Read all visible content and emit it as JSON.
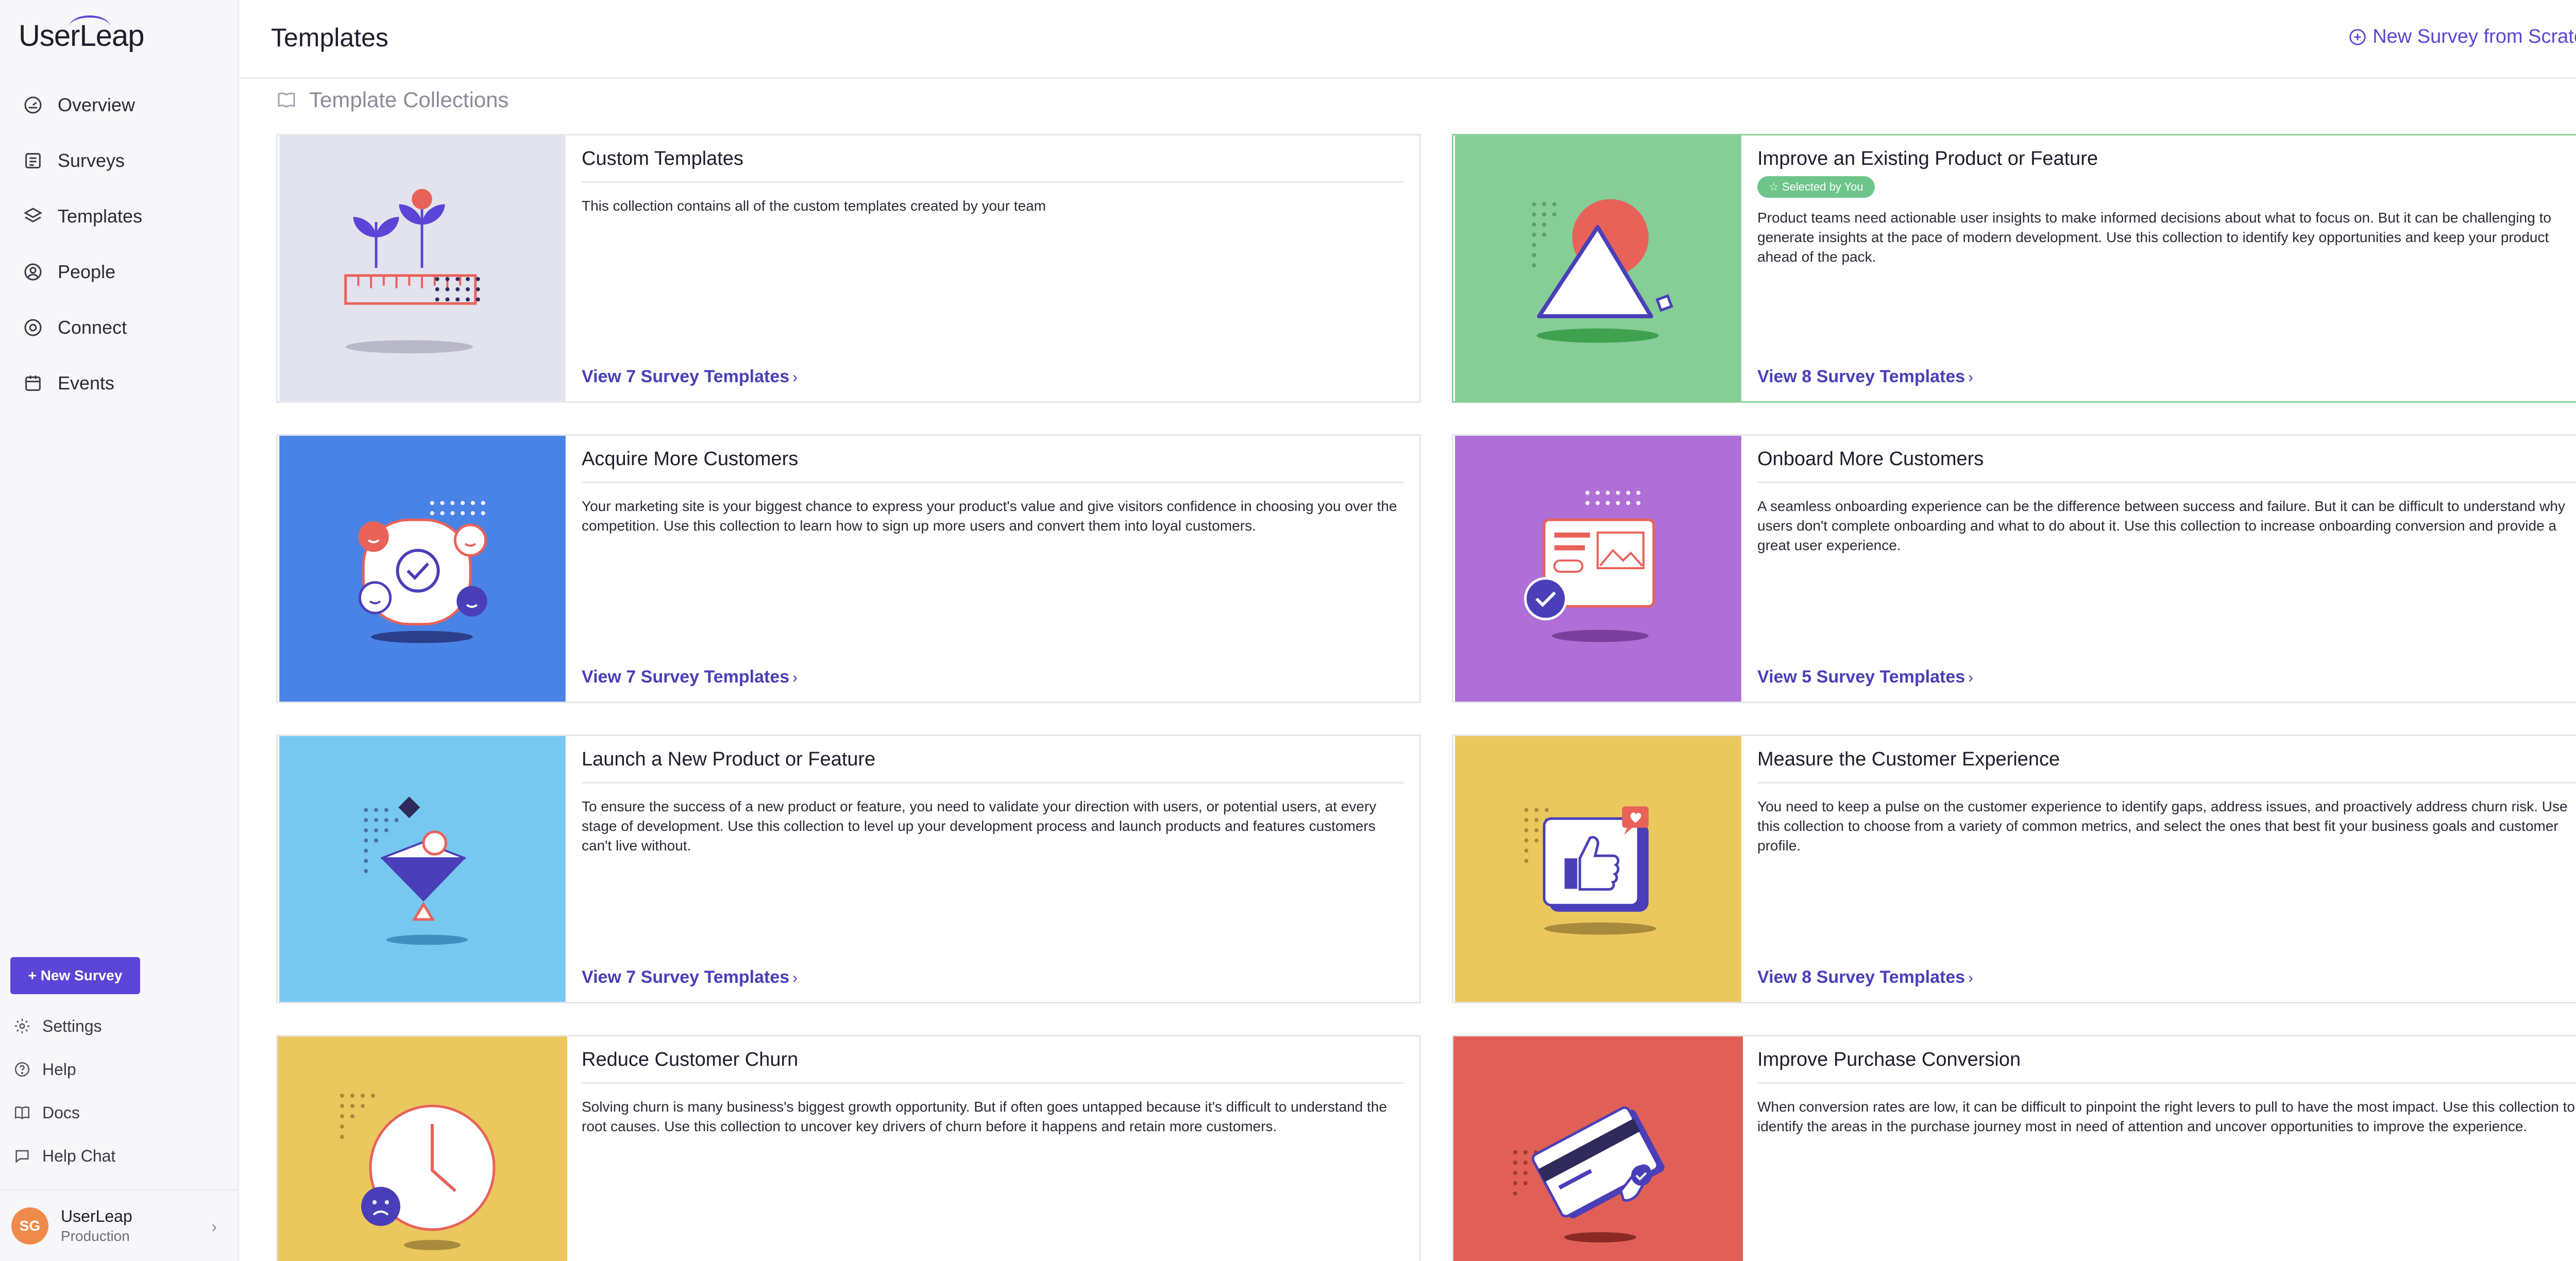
{
  "brand": "UserLeap",
  "sidebar": {
    "nav": [
      {
        "label": "Overview",
        "icon": "dashboard-icon"
      },
      {
        "label": "Surveys",
        "icon": "surveys-icon"
      },
      {
        "label": "Templates",
        "icon": "layers-icon"
      },
      {
        "label": "People",
        "icon": "person-icon"
      },
      {
        "label": "Connect",
        "icon": "connect-icon"
      },
      {
        "label": "Events",
        "icon": "calendar-icon"
      }
    ],
    "new_survey_label": "+ New Survey",
    "bottom": [
      {
        "label": "Settings",
        "icon": "gear-icon"
      },
      {
        "label": "Help",
        "icon": "help-icon"
      },
      {
        "label": "Docs",
        "icon": "book-icon"
      },
      {
        "label": "Help Chat",
        "icon": "chat-icon"
      }
    ],
    "account": {
      "initials": "SG",
      "name": "UserLeap",
      "env": "Production"
    }
  },
  "header": {
    "title": "Templates",
    "new_scratch_label": "New Survey from Scratch"
  },
  "collections_label": "Template Collections",
  "cards": [
    {
      "title": "Custom Templates",
      "badge": "",
      "desc": "This collection contains all of the custom templates created by your team",
      "link": "View 7 Survey Templates",
      "color": "#e4e4ee",
      "art": "plants-ruler"
    },
    {
      "title": "Improve an Existing Product or Feature",
      "badge": "☆ Selected by You",
      "desc": "Product teams need actionable user insights to make informed decisions about what to focus on. But it can be challenging to generate insights at the pace of modern development. Use this collection to identify key opportunities and keep your product ahead of the pack.",
      "link": "View 8 Survey Templates",
      "color": "#86cd96",
      "art": "triangle-sun"
    },
    {
      "title": "Acquire More Customers",
      "badge": "",
      "desc": "Your marketing site is your biggest chance to express your product's value and give visitors confidence in choosing you over the competition. Use this collection to learn how to sign up more users and convert them into loyal customers.",
      "link": "View 7 Survey Templates",
      "color": "#4a83e6",
      "art": "faces-check"
    },
    {
      "title": "Onboard More Customers",
      "badge": "",
      "desc": "A seamless onboarding experience can be the difference between success and failure. But it can be difficult to understand why users don't complete onboarding and what to do about it. Use this collection to increase onboarding conversion and provide a great user experience.",
      "link": "View 5 Survey Templates",
      "color": "#b06fd6",
      "art": "form-check"
    },
    {
      "title": "Launch a New Product or Feature",
      "badge": "",
      "desc": "To ensure the success of a new product or feature, you need to validate your direction with users, or potential users, at every stage of development. Use this collection to level up your development process and launch products and features customers can't live without.",
      "link": "View 7 Survey Templates",
      "color": "#77c8f0",
      "art": "spinning-top"
    },
    {
      "title": "Measure the Customer Experience",
      "badge": "",
      "desc": "You need to keep a pulse on the customer experience to identify gaps, address issues, and proactively address churn risk. Use this collection to choose from a variety of common metrics, and select the ones that best fit your business goals and customer profile.",
      "link": "View 8 Survey Templates",
      "color": "#ebc85e",
      "art": "thumbs-up"
    },
    {
      "title": "Reduce Customer Churn",
      "badge": "",
      "desc": "Solving churn is many business's biggest growth opportunity. But if often goes untapped because it's difficult to understand the root causes. Use this collection to uncover key drivers of churn before it happens and retain more customers.",
      "link": "",
      "color": "#ebc85e",
      "art": "clock"
    },
    {
      "title": "Improve Purchase Conversion",
      "badge": "",
      "desc": "When conversion rates are low, it can be difficult to pinpoint the right levers to pull to have the most impact. Use this collection to identify the areas in the purchase journey most in need of attention and uncover opportunities to improve the experience.",
      "link": "",
      "color": "#e06058",
      "art": "credit-card"
    }
  ]
}
